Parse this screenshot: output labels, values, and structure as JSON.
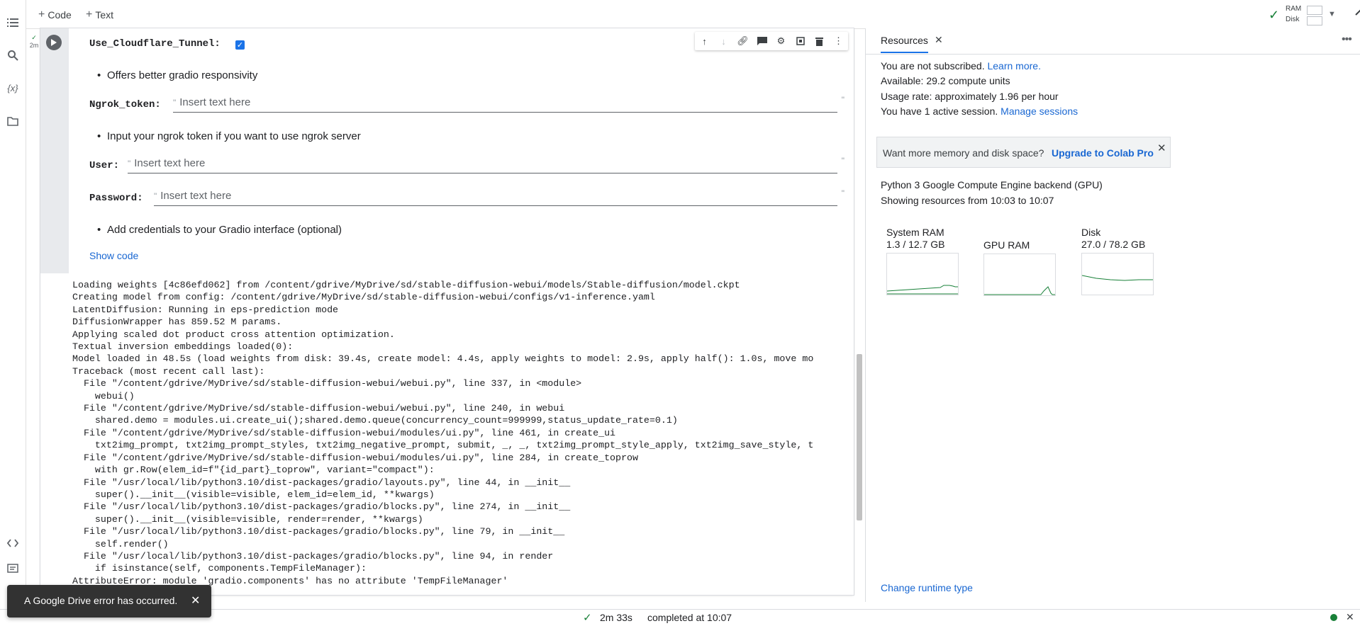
{
  "toolbar": {
    "add_code": "Code",
    "add_text": "Text",
    "ram_label": "RAM",
    "disk_label": "Disk"
  },
  "rail": {
    "icons": [
      "toc-icon",
      "search-icon",
      "variables-icon",
      "folder-icon",
      "code-snippets-icon",
      "terminal-icon"
    ],
    "variables_glyph": "{x}"
  },
  "cell": {
    "exec_time": "2m",
    "fields": {
      "cloudflare_label": "Use_Cloudflare_Tunnel:",
      "cloudflare_checked": true,
      "ngrok_label": "Ngrok_token:",
      "ngrok_placeholder": "Insert text here",
      "user_label": "User:",
      "user_placeholder": "Insert text here",
      "password_label": "Password:",
      "password_placeholder": "Insert text here"
    },
    "bullets": {
      "b1": "Offers better gradio responsivity",
      "b2": "Input your ngrok token if you want to use ngrok server",
      "b3": "Add credentials to your Gradio interface (optional)"
    },
    "show_code": "Show code",
    "output": "Loading weights [4c86efd062] from /content/gdrive/MyDrive/sd/stable-diffusion-webui/models/Stable-diffusion/model.ckpt\nCreating model from config: /content/gdrive/MyDrive/sd/stable-diffusion-webui/configs/v1-inference.yaml\nLatentDiffusion: Running in eps-prediction mode\nDiffusionWrapper has 859.52 M params.\nApplying scaled dot product cross attention optimization.\nTextual inversion embeddings loaded(0):\nModel loaded in 48.5s (load weights from disk: 39.4s, create model: 4.4s, apply weights to model: 2.9s, apply half(): 1.0s, move mo\nTraceback (most recent call last):\n  File \"/content/gdrive/MyDrive/sd/stable-diffusion-webui/webui.py\", line 337, in <module>\n    webui()\n  File \"/content/gdrive/MyDrive/sd/stable-diffusion-webui/webui.py\", line 240, in webui\n    shared.demo = modules.ui.create_ui();shared.demo.queue(concurrency_count=999999,status_update_rate=0.1)\n  File \"/content/gdrive/MyDrive/sd/stable-diffusion-webui/modules/ui.py\", line 461, in create_ui\n    txt2img_prompt, txt2img_prompt_styles, txt2img_negative_prompt, submit, _, _, txt2img_prompt_style_apply, txt2img_save_style, t\n  File \"/content/gdrive/MyDrive/sd/stable-diffusion-webui/modules/ui.py\", line 284, in create_toprow\n    with gr.Row(elem_id=f\"{id_part}_toprow\", variant=\"compact\"):\n  File \"/usr/local/lib/python3.10/dist-packages/gradio/layouts.py\", line 44, in __init__\n    super().__init__(visible=visible, elem_id=elem_id, **kwargs)\n  File \"/usr/local/lib/python3.10/dist-packages/gradio/blocks.py\", line 274, in __init__\n    super().__init__(visible=visible, render=render, **kwargs)\n  File \"/usr/local/lib/python3.10/dist-packages/gradio/blocks.py\", line 79, in __init__\n    self.render()\n  File \"/usr/local/lib/python3.10/dist-packages/gradio/blocks.py\", line 94, in render\n    if isinstance(self, components.TempFileManager):\nAttributeError: module 'gradio.components' has no attribute 'TempFileManager'"
  },
  "resources": {
    "title": "Resources",
    "not_subscribed": "You are not subscribed.",
    "learn_more": "Learn more.",
    "available": "Available: 29.2 compute units",
    "usage_rate": "Usage rate: approximately 1.96 per hour",
    "active_session": "You have 1 active session.",
    "manage_sessions": "Manage sessions",
    "upsell_text": "Want more memory and disk space?",
    "upsell_link": "Upgrade to Colab Pro",
    "backend": "Python 3 Google Compute Engine backend (GPU)",
    "showing": "Showing resources from 10:03 to 10:07",
    "gauges": [
      {
        "name": "System RAM",
        "value": "1.3 / 12.7 GB"
      },
      {
        "name": "GPU RAM",
        "value": ""
      },
      {
        "name": "Disk",
        "value": "27.0 / 78.2 GB"
      }
    ],
    "change_runtime": "Change runtime type"
  },
  "status": {
    "duration": "2m 33s",
    "completed": "completed at 10:07"
  },
  "toast": {
    "message": "A Google Drive error has occurred."
  },
  "colors": {
    "accent": "#1a73e8",
    "link": "#1967d2",
    "success": "#188038",
    "toast_bg": "#323232"
  }
}
